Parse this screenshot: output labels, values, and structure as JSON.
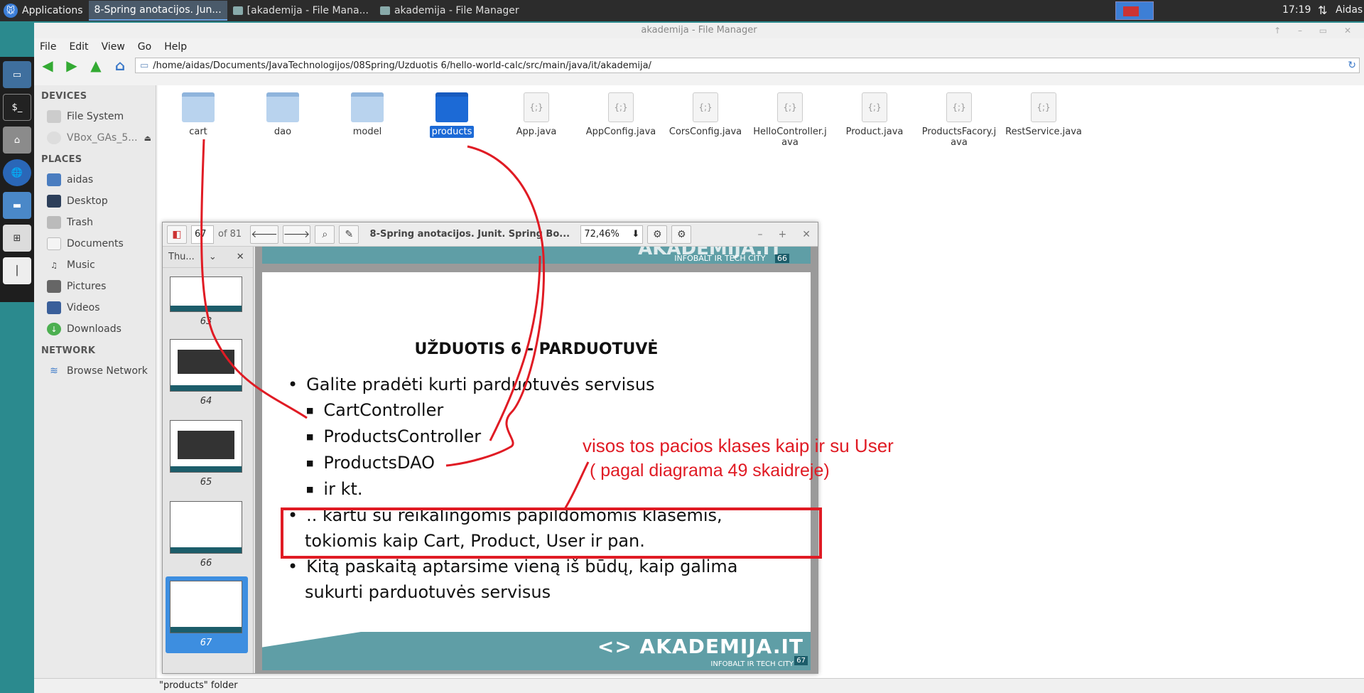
{
  "panel": {
    "applications": "Applications",
    "tasks": [
      "8-Spring anotacijos. Jun...",
      "[akademija - File Mana...",
      "akademija - File Manager"
    ],
    "clock": "17:19",
    "user": "Aidas"
  },
  "fm": {
    "title": "akademija - File Manager",
    "menu": [
      "File",
      "Edit",
      "View",
      "Go",
      "Help"
    ],
    "path": "/home/aidas/Documents/JavaTechnologijos/08Spring/Uzduotis 6/hello-world-calc/src/main/java/it/akademija/",
    "sidebar": {
      "devices_head": "DEVICES",
      "devices": [
        "File System",
        "VBox_GAs_5..."
      ],
      "places_head": "PLACES",
      "places": [
        "aidas",
        "Desktop",
        "Trash",
        "Documents",
        "Music",
        "Pictures",
        "Videos",
        "Downloads"
      ],
      "network_head": "NETWORK",
      "network": [
        "Browse Network"
      ]
    },
    "files": [
      {
        "name": "cart",
        "type": "folder"
      },
      {
        "name": "dao",
        "type": "folder"
      },
      {
        "name": "model",
        "type": "folder"
      },
      {
        "name": "products",
        "type": "folder-selected"
      },
      {
        "name": "App.java",
        "type": "java"
      },
      {
        "name": "AppConfig.java",
        "type": "java"
      },
      {
        "name": "CorsConfig.java",
        "type": "java"
      },
      {
        "name": "HelloController.java",
        "type": "java"
      },
      {
        "name": "Product.java",
        "type": "java"
      },
      {
        "name": "ProductsFacory.java",
        "type": "java"
      },
      {
        "name": "RestService.java",
        "type": "java"
      }
    ],
    "status": "\"products\" folder"
  },
  "pdf": {
    "page": "67",
    "of": "of 81",
    "title": "8-Spring anotacijos. Junit. Spring Bo...",
    "zoom": "72,46%",
    "thumbs_label": "Thu...",
    "thumb_numbers": [
      "63",
      "64",
      "65",
      "66",
      "67"
    ],
    "slide": {
      "heading": "UŽDUOTIS 6 - PARDUOTUVĖ",
      "b1": "Galite pradėti kurti parduotuvės servisus",
      "sub": [
        "CartController",
        "ProductsController",
        "ProductsDAO",
        "ir kt."
      ],
      "b2": ".. kartu su reikalingomis papildomomis klasėmis, tokiomis kaip Cart, Product, User ir pan.",
      "b3": "Kitą paskaitą aptarsime vieną iš būdų, kaip galima sukurti parduotuvės servisus",
      "brand": "AKADEMIJA.IT",
      "brand_sub": "INFOBALT IR TECH CITY",
      "page_badge": "67",
      "prev_badge": "66"
    }
  },
  "annotations": {
    "line1": "visos tos pacios klases kaip ir su User",
    "line2": "( pagal diagrama 49 skaidreje)"
  },
  "colors": {
    "annotation": "#e01b24",
    "selection": "#1c6ad6",
    "slide_teal": "#5f9ea6"
  }
}
